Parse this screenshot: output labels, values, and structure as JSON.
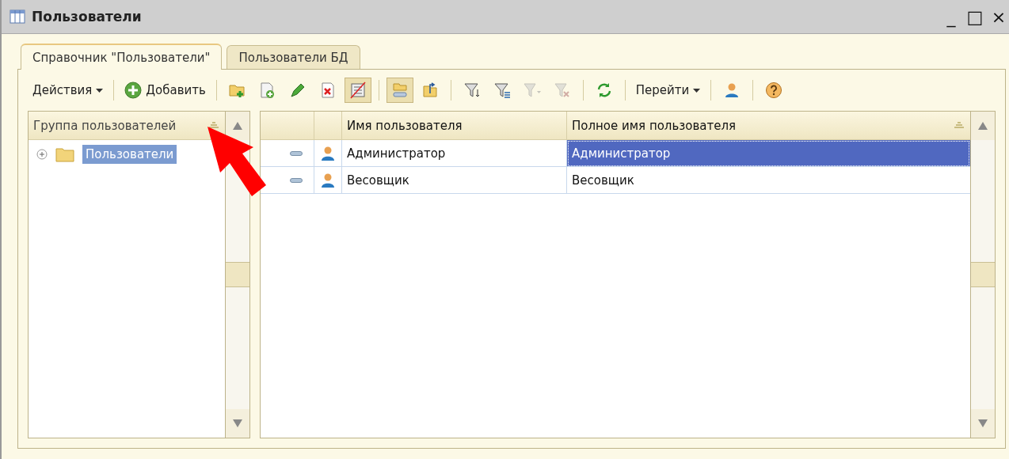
{
  "window": {
    "title": "Пользователи",
    "controls": [
      "_",
      "□",
      "×"
    ]
  },
  "tabs": [
    {
      "label": "Справочник \"Пользователи\"",
      "selected": true
    },
    {
      "label": "Пользователи БД",
      "selected": false
    }
  ],
  "toolbar": [
    {
      "kind": "menu",
      "label": "Действия"
    },
    {
      "kind": "separator"
    },
    {
      "kind": "button",
      "label": "Добавить"
    },
    {
      "kind": "separator"
    },
    {
      "kind": "icon",
      "pressed": false,
      "disabled": false
    },
    {
      "kind": "icon",
      "pressed": false,
      "disabled": false
    },
    {
      "kind": "icon",
      "pressed": false,
      "disabled": false
    },
    {
      "kind": "icon",
      "pressed": false,
      "disabled": false
    },
    {
      "kind": "icon",
      "pressed": true,
      "disabled": false
    },
    {
      "kind": "separator"
    },
    {
      "kind": "icon",
      "pressed": true,
      "disabled": false
    },
    {
      "kind": "icon",
      "pressed": false,
      "disabled": false
    },
    {
      "kind": "separator"
    },
    {
      "kind": "icon",
      "pressed": false,
      "disabled": false
    },
    {
      "kind": "icon",
      "pressed": false,
      "disabled": false
    },
    {
      "kind": "icon",
      "pressed": false,
      "disabled": true
    },
    {
      "kind": "icon",
      "pressed": false,
      "disabled": true
    },
    {
      "kind": "separator"
    },
    {
      "kind": "icon",
      "pressed": false,
      "disabled": false
    },
    {
      "kind": "separator"
    },
    {
      "kind": "menu",
      "label": "Перейти"
    },
    {
      "kind": "separator"
    },
    {
      "kind": "icon",
      "pressed": false,
      "disabled": false
    },
    {
      "kind": "separator"
    },
    {
      "kind": "icon",
      "pressed": false,
      "disabled": false
    }
  ],
  "tree": {
    "column": "Группа пользователей",
    "items": [
      {
        "label": "Пользователи",
        "expanded": false,
        "selected": true
      }
    ]
  },
  "table": {
    "columns": [
      "Имя пользователя",
      "Полное имя пользователя"
    ],
    "rows": [
      {
        "name": "Администратор",
        "full_name": "Администратор",
        "selected": true
      },
      {
        "name": "Весовщик",
        "full_name": "Весовщик",
        "selected": false
      }
    ]
  }
}
